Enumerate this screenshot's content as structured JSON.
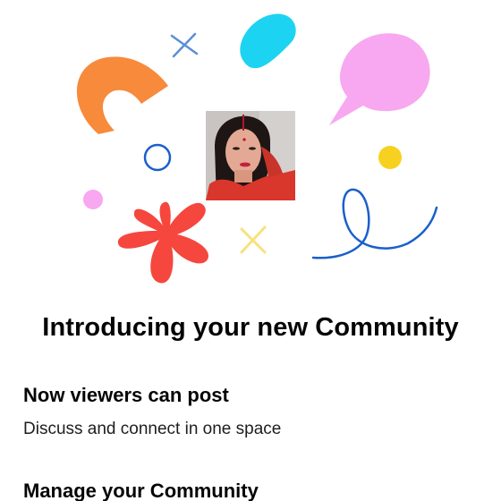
{
  "intro": {
    "title": "Introducing your new Community"
  },
  "features": [
    {
      "heading": "Now viewers can post",
      "description": "Discuss and connect in one space"
    },
    {
      "heading": "Manage your Community"
    }
  ],
  "illustration": {
    "colors": {
      "orange_arch": "#F78A3B",
      "cyan_blob": "#1DD3F2",
      "pink_speech_bubble": "#F7A8F0",
      "yellow_dot": "#F7D11F",
      "red_flower": "#F5473E",
      "blue_line": "#1A5FCC",
      "pink_dot": "#F7A8F0",
      "yellow_x": "#F7E27C"
    },
    "icons": [
      "orange-arch-shape",
      "cyan-blob-shape",
      "speech-bubble-icon",
      "cross-mark-icon",
      "circle-outline-icon",
      "flower-shape",
      "squiggle-line"
    ]
  },
  "avatar": {
    "icon": "profile-photo"
  }
}
